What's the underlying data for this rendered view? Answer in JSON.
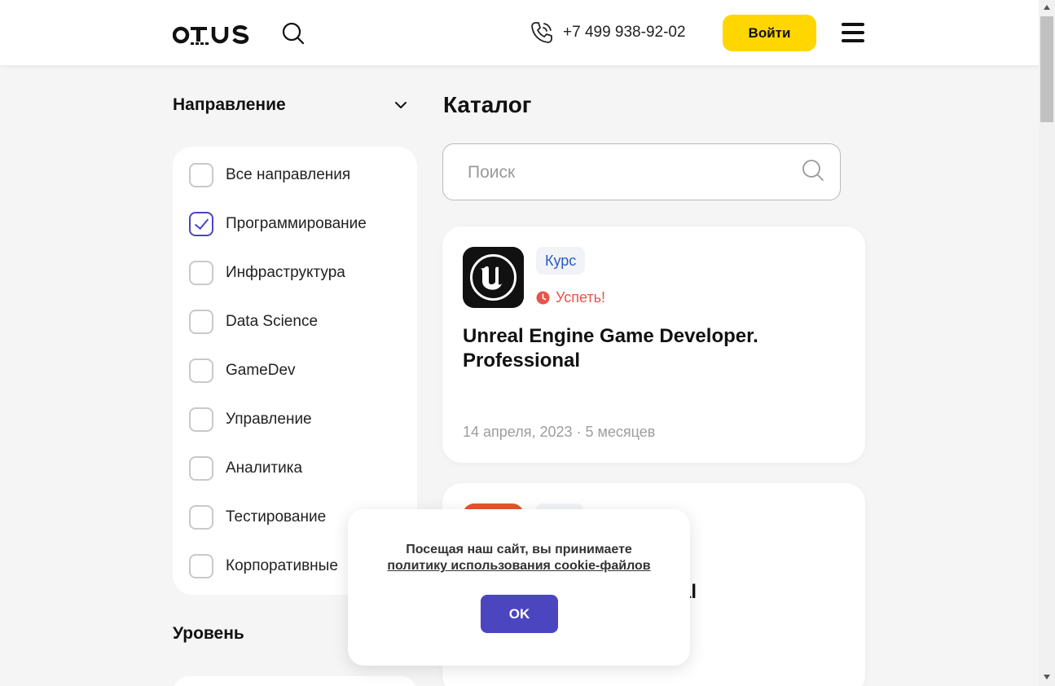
{
  "header": {
    "logo": "otus",
    "phone": "+7 499 938-92-02",
    "login_label": "Войти"
  },
  "sidebar": {
    "direction_title": "Направление",
    "level_title": "Уровень",
    "directions": [
      {
        "label": "Все направления",
        "checked": false
      },
      {
        "label": "Программирование",
        "checked": true
      },
      {
        "label": "Инфраструктура",
        "checked": false
      },
      {
        "label": "Data Science",
        "checked": false
      },
      {
        "label": "GameDev",
        "checked": false
      },
      {
        "label": "Управление",
        "checked": false
      },
      {
        "label": "Аналитика",
        "checked": false
      },
      {
        "label": "Тестирование",
        "checked": false
      },
      {
        "label": "Корпоративные",
        "checked": false
      }
    ]
  },
  "catalog": {
    "title": "Каталог",
    "search_placeholder": "Поиск",
    "search_value": "",
    "cards": [
      {
        "tag": "Курс",
        "hurry": "Успеть!",
        "title": "Unreal Engine Game Developer. Professional",
        "meta": "14 апреля, 2023 · 5 месяцев"
      },
      {
        "title": "ional"
      }
    ]
  },
  "cookie": {
    "text": "Посещая наш сайт, вы принимаете",
    "link": "политику использования cookie-файлов",
    "ok_label": "OK"
  },
  "colors": {
    "accent_yellow": "#ffd600",
    "accent_purple": "#4b45c0",
    "hurry_red": "#e8534a",
    "tag_blue": "#2a5bbf"
  }
}
